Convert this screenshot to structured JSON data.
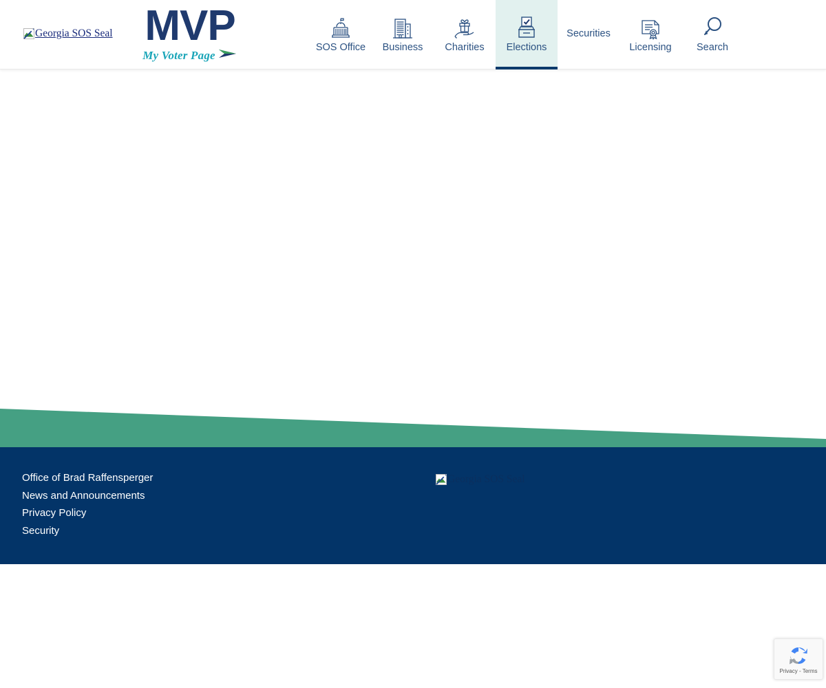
{
  "header": {
    "seal_alt": "Georgia SOS Seal",
    "logo": {
      "title": "MVP",
      "tagline": "My Voter Page",
      "arrow_icon": "arrow-chevron-icon"
    }
  },
  "nav": {
    "items": [
      {
        "label": "SOS Office",
        "icon": "capitol-building-icon",
        "active": false
      },
      {
        "label": "Business",
        "icon": "office-buildings-icon",
        "active": false
      },
      {
        "label": "Charities",
        "icon": "gift-in-hand-icon",
        "active": false
      },
      {
        "label": "Elections",
        "icon": "ballot-box-icon",
        "active": true
      },
      {
        "label": "Securities",
        "icon": "",
        "active": false
      },
      {
        "label": "Licensing",
        "icon": "certificate-icon",
        "active": false
      },
      {
        "label": "Search",
        "icon": "search-icon",
        "active": false
      }
    ]
  },
  "footer": {
    "links": [
      {
        "label": "Office of Brad Raffensperger"
      },
      {
        "label": "News and Announcements"
      },
      {
        "label": "Privacy Policy"
      },
      {
        "label": "Security"
      }
    ],
    "seal_alt": "Georgia SOS Seal"
  },
  "recaptcha": {
    "text": "Privacy - Terms",
    "logo_icon": "recaptcha-icon"
  },
  "colors": {
    "navy": "#033468",
    "logo_navy": "#1f3a6e",
    "teal": "#1aa5b8",
    "nav_blue": "#2c5282",
    "active_tab_bg": "#e2f1ef",
    "active_tab_border": "#0b3a6b",
    "wedge_green": "#45a083"
  }
}
